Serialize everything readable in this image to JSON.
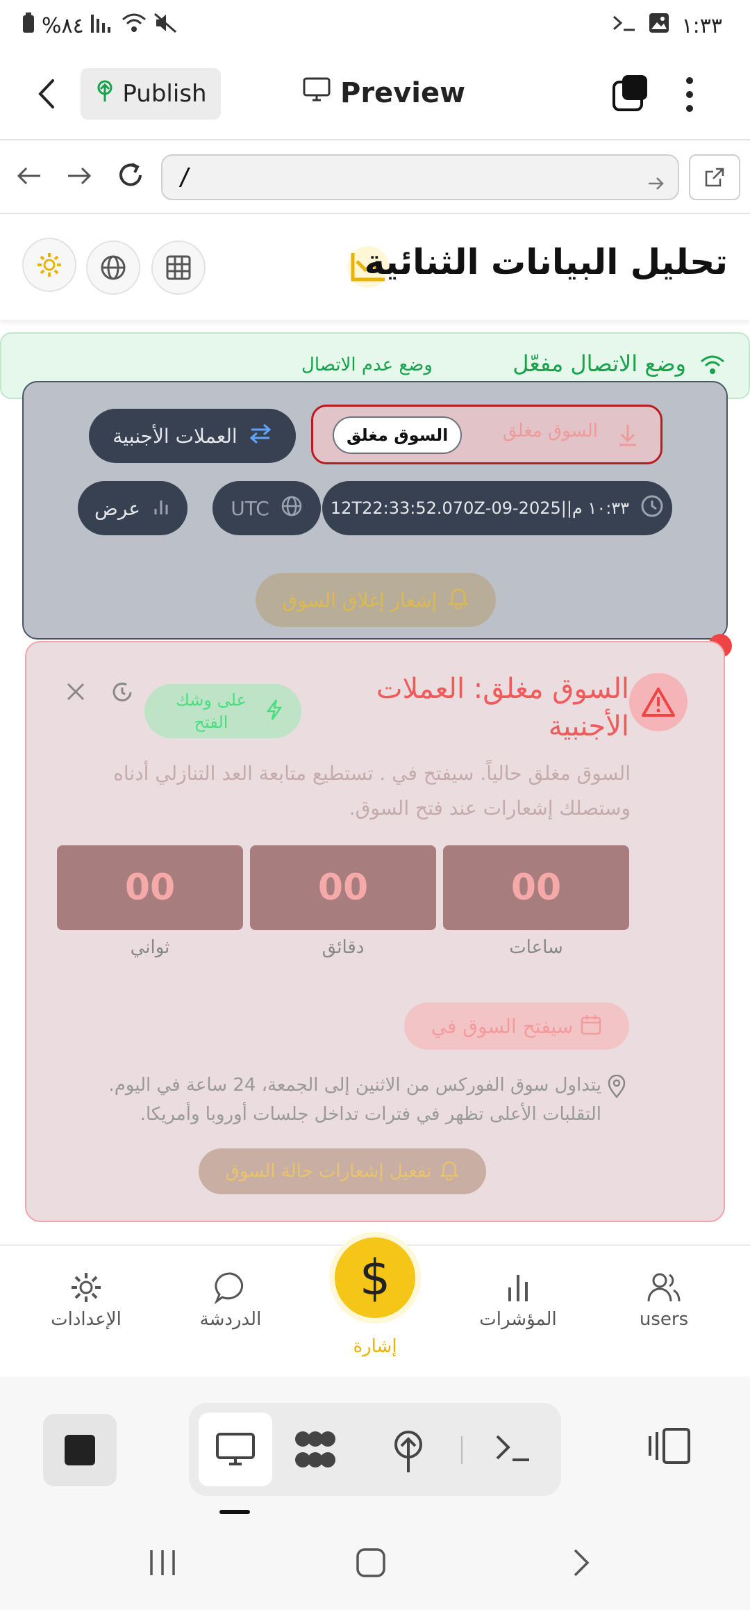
{
  "status_bar": {
    "time": "١:٣٣",
    "battery": "%٨٤"
  },
  "app_header": {
    "publish_label": "Publish",
    "preview_label": "Preview"
  },
  "browser": {
    "url": "/"
  },
  "page": {
    "title": "تحليل البيانات الثنائية"
  },
  "offline_bar": {
    "mode_on": "وضع الاتصال مفعّل",
    "mode_off": "وضع عدم الاتصال"
  },
  "panel": {
    "forex_label": "العملات الأجنبية",
    "market_status_faded": "السوق مغلق",
    "market_status_chip": "السوق مغلق",
    "view_label": "عرض",
    "timezone": "UTC",
    "datetime": "١٠:٣٣ م||2025-09-12T22:33:52.070Z",
    "notify_close": "إشعار إغلاق السوق"
  },
  "card": {
    "title": "السوق مغلق: العملات الأجنبية",
    "about_to_open": "على وشك الفتح",
    "description": "السوق مغلق حالياً. سيفتح في . تستطيع متابعة العد التنازلي أدناه وستصلك إشعارات عند فتح السوق.",
    "hours_value": "00",
    "minutes_value": "00",
    "seconds_value": "00",
    "hours_label": "ساعات",
    "minutes_label": "دقائق",
    "seconds_label": "ثواني",
    "opens_at": "سيفتح السوق في",
    "info": "يتداول سوق الفوركس من الاثنين إلى الجمعة، 24 ساعة في اليوم. التقلبات الأعلى تظهر في فترات تداخل جلسات أوروبا وأمريكا.",
    "enable_notifications": "تفعيل إشعارات حالة السوق"
  },
  "bottom_nav": {
    "items": [
      {
        "label": "users"
      },
      {
        "label": "المؤشرات"
      },
      {
        "label": "إشارة"
      },
      {
        "label": "الدردشة"
      },
      {
        "label": "الإعدادات"
      }
    ]
  },
  "colors": {
    "accent": "#f5c518",
    "success": "#16a34a",
    "danger": "#ef4444",
    "panel_dark": "#374151"
  }
}
